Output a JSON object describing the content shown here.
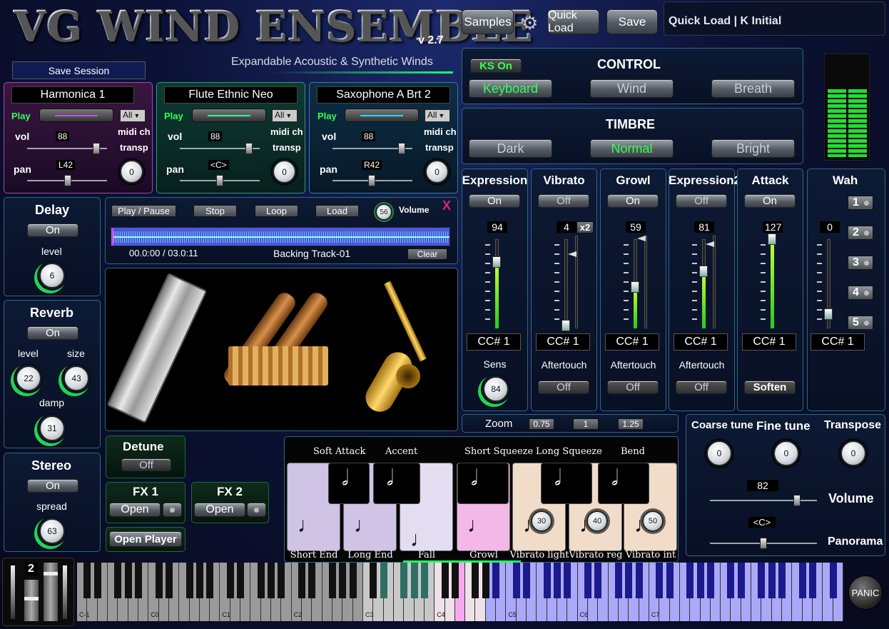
{
  "title": "VG WIND ENSEMBLE",
  "version": "v 2.7",
  "subtitle": "Expandable Acoustic & Synthetic Winds",
  "top": {
    "samples": "Samples",
    "quick_load": "Quick Load",
    "save": "Save",
    "preset": "Quick Load | K Initial"
  },
  "save_session": "Save Session",
  "instruments": [
    {
      "name": "Harmonica 1",
      "play": "Play",
      "all": "All",
      "vol_label": "vol",
      "vol": "88",
      "pan_label": "pan",
      "pan": "L42",
      "midi_ch": "midi ch",
      "transp": "transp",
      "transp_val": "0"
    },
    {
      "name": "Flute Ethnic Neo",
      "play": "Play",
      "all": "All",
      "vol_label": "vol",
      "vol": "88",
      "pan_label": "pan",
      "pan": "<C>",
      "midi_ch": "midi ch",
      "transp": "transp",
      "transp_val": "0"
    },
    {
      "name": "Saxophone A Brt 2",
      "play": "Play",
      "all": "All",
      "vol_label": "vol",
      "vol": "88",
      "pan_label": "pan",
      "pan": "R42",
      "midi_ch": "midi ch",
      "transp": "transp",
      "transp_val": "0"
    }
  ],
  "control": {
    "title": "CONTROL",
    "ks": "KS On",
    "keyboard": "Keyboard",
    "wind": "Wind",
    "breath": "Breath"
  },
  "timbre": {
    "title": "TIMBRE",
    "dark": "Dark",
    "normal": "Normal",
    "bright": "Bright"
  },
  "delay": {
    "title": "Delay",
    "state": "On",
    "level_label": "level",
    "level": "6"
  },
  "reverb": {
    "title": "Reverb",
    "state": "On",
    "level_label": "level",
    "size_label": "size",
    "damp_label": "damp",
    "level": "22",
    "size": "43",
    "damp": "31"
  },
  "stereo": {
    "title": "Stereo",
    "state": "On",
    "spread_label": "spread",
    "spread": "63"
  },
  "player": {
    "play_pause": "Play / Pause",
    "stop": "Stop",
    "loop": "Loop",
    "load": "Load",
    "volume": "56",
    "volume_label": "Volume",
    "close": "X",
    "time": "00.0:00 / 03.0:11",
    "track": "Backing Track-01",
    "clear": "Clear"
  },
  "detune": {
    "title": "Detune",
    "state": "Off"
  },
  "fx1": {
    "title": "FX 1",
    "open": "Open"
  },
  "fx2": {
    "title": "FX 2",
    "open": "Open"
  },
  "open_player": "Open Player",
  "mod": [
    {
      "title": "Expression",
      "state": "On",
      "value": "94",
      "cc": "CC# 1",
      "sub": "Sens",
      "knob": "84",
      "level": 0.74
    },
    {
      "title": "Vibrato",
      "state": "Off",
      "value": "4",
      "x2": "x2",
      "cc": "CC# 1",
      "sub": "Aftertouch",
      "sub_state": "Off",
      "level": 0.03
    },
    {
      "title": "Growl",
      "state": "On",
      "value": "59",
      "cc": "CC# 1",
      "sub": "Aftertouch",
      "sub_state": "Off",
      "level": 0.46
    },
    {
      "title": "Expression2",
      "state": "Off",
      "value": "81",
      "cc": "CC# 1",
      "sub": "Aftertouch",
      "sub_state": "Off",
      "level": 0.64
    },
    {
      "title": "Attack",
      "state": "On",
      "value": "127",
      "cc": "CC# 1",
      "sub_state": "Soften",
      "level": 1.0
    }
  ],
  "wah": {
    "title": "Wah",
    "value": "0",
    "cc": "CC# 1",
    "buttons": [
      "1",
      "2",
      "3",
      "4",
      "5"
    ]
  },
  "zoom": {
    "label": "Zoom",
    "options": [
      "0.75",
      "1",
      "1.25"
    ]
  },
  "articulations": {
    "top": [
      "Soft Attack",
      "Accent",
      "Short Squeeze",
      "Long Squeeze",
      "Bend"
    ],
    "bottom": [
      "Short End",
      "Long End",
      "Fall",
      "Growl",
      "Vibrato light",
      "Vibrato reg",
      "Vibrato int"
    ],
    "knobs": [
      "30",
      "40",
      "50"
    ]
  },
  "tune": {
    "coarse": "Coarse tune",
    "fine": "Fine tune",
    "transpose": "Transpose",
    "coarse_val": "0",
    "fine_val": "0",
    "transpose_val": "0",
    "volume_label": "Volume",
    "volume": "82",
    "pan_label": "Panorama",
    "pan": "<C>"
  },
  "keyboard": {
    "octave": "2",
    "labels": [
      "C-1",
      "C0",
      "C1",
      "C2",
      "C3",
      "C4",
      "C5",
      "C6",
      "C7"
    ],
    "panic": "PANIC"
  },
  "colors": {
    "green": "#33ff55",
    "panel_border": "#2c6a80"
  }
}
